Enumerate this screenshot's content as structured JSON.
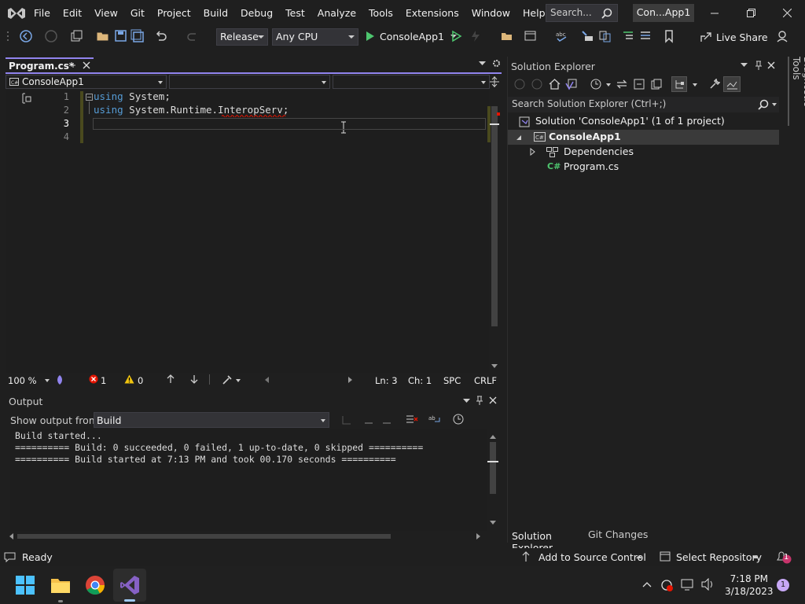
{
  "menubar": {
    "items": [
      "File",
      "Edit",
      "View",
      "Git",
      "Project",
      "Build",
      "Debug",
      "Test",
      "Analyze",
      "Tools",
      "Extensions",
      "Window",
      "Help"
    ],
    "search_placeholder": "Search...",
    "solution_name": "Con...App1"
  },
  "toolbar": {
    "configuration": "Release",
    "platform": "Any CPU",
    "start_label": "ConsoleApp1",
    "live_share": "Live Share"
  },
  "editor": {
    "tab_title": "Program.cs*",
    "nav_project": "ConsoleApp1",
    "lines": [
      {
        "num": "1",
        "kw": "using",
        "ns": " System;"
      },
      {
        "num": "2",
        "kw": "using",
        "ns": " System.Runtime.InteropServ;"
      },
      {
        "num": "3",
        "kw": "",
        "ns": ""
      },
      {
        "num": "4",
        "kw": "",
        "ns": ""
      }
    ],
    "zoom": "100 %",
    "errors": "1",
    "warnings": "0",
    "position_line": "Ln: 3",
    "position_char": "Ch: 1",
    "whitespace": "SPC",
    "line_ending": "CRLF"
  },
  "output": {
    "title": "Output",
    "source_label": "Show output from:",
    "source_value": "Build",
    "lines": [
      "Build started...",
      "========== Build: 0 succeeded, 0 failed, 1 up-to-date, 0 skipped ==========",
      "========== Build started at 7:13 PM and took 00.170 seconds =========="
    ]
  },
  "solution_explorer": {
    "title": "Solution Explorer",
    "search_placeholder": "Search Solution Explorer (Ctrl+;)",
    "solution_node": "Solution 'ConsoleApp1' (1 of 1 project)",
    "project_node": "ConsoleApp1",
    "dependencies_node": "Dependencies",
    "file_node": "Program.cs",
    "tab_solution_explorer": "Solution Explorer",
    "tab_git_changes": "Git Changes"
  },
  "side_panel": {
    "diagnostic_tools": "Diagnostic Tools"
  },
  "statusbar": {
    "status": "Ready",
    "add_source_control": "Add to Source Control",
    "select_repository": "Select Repository",
    "notifications": "1"
  },
  "taskbar": {
    "time": "7:18 PM",
    "date": "3/18/2023",
    "notification_count": "1"
  },
  "colors": {
    "accent": "#9184ee",
    "keyword": "#569cd6",
    "error": "#e51400",
    "run_green": "#4ec66f"
  }
}
